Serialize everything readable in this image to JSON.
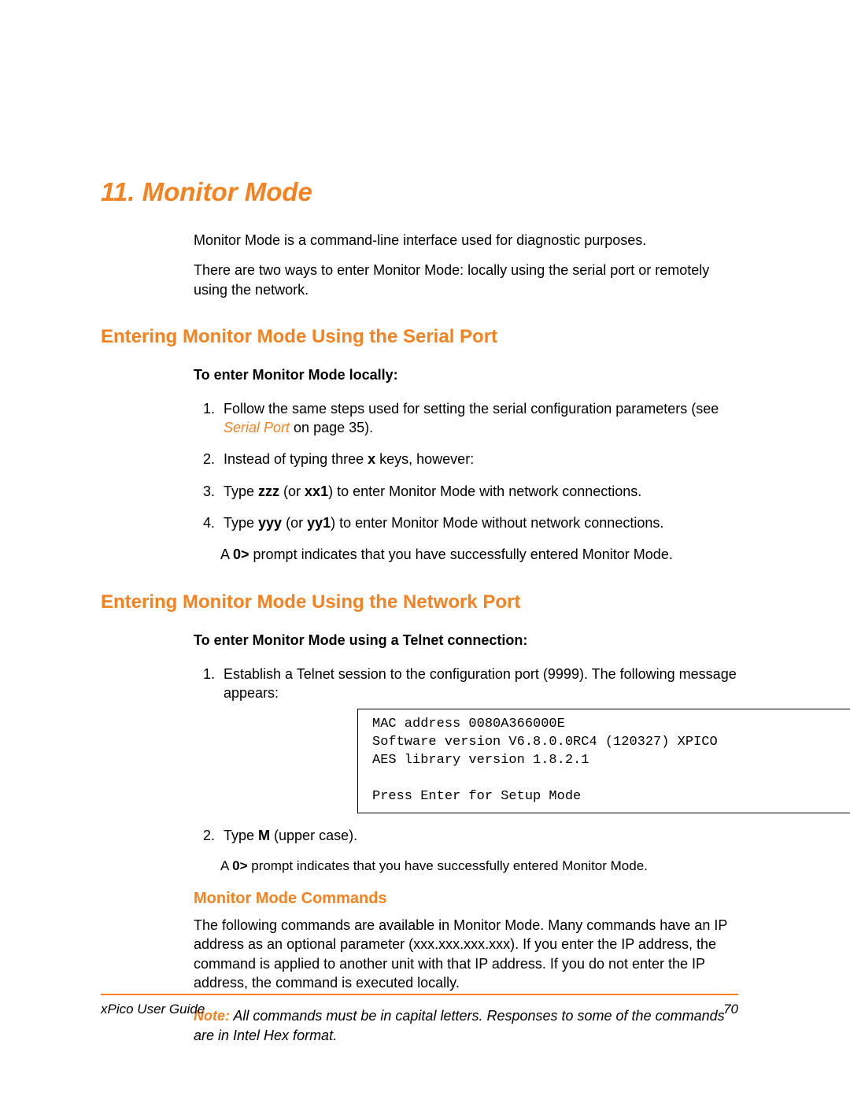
{
  "h1": "11. Monitor Mode",
  "intro": {
    "p1": "Monitor Mode is a command-line interface used for diagnostic purposes.",
    "p2": "There are two ways to enter Monitor Mode: locally using the serial port or remotely using the network."
  },
  "section1": {
    "heading": "Entering Monitor Mode Using the Serial Port",
    "sub": "To enter Monitor Mode locally:",
    "step1_pre": "Follow the same steps used for setting the serial configuration parameters (see ",
    "step1_link": "Serial Port",
    "step1_post": " on page 35).",
    "step2_pre": "Instead of typing three ",
    "step2_b": "x",
    "step2_post": " keys, however:",
    "step3_a": "Type ",
    "step3_b1": "zzz",
    "step3_b": " (or ",
    "step3_b2": "xx1",
    "step3_c": ") to enter Monitor Mode with network connections.",
    "step4_a": "Type ",
    "step4_b1": "yyy",
    "step4_b": " (or ",
    "step4_b2": "yy1",
    "step4_c": ") to enter Monitor Mode without network connections.",
    "result_a": "A ",
    "result_b": "0>",
    "result_c": " prompt indicates that you have successfully entered Monitor Mode."
  },
  "section2": {
    "heading": "Entering Monitor Mode Using the Network Port",
    "sub": "To enter Monitor Mode using a Telnet connection:",
    "step1": "Establish a Telnet session to the configuration port (9999). The following message appears:",
    "code": "MAC address 0080A366000E\nSoftware version V6.8.0.0RC4 (120327) XPICO\nAES library version 1.8.2.1\n\nPress Enter for Setup Mode",
    "step2_a": "Type ",
    "step2_b": "M",
    "step2_c": " (upper case).",
    "result_a": "A ",
    "result_b": "0>",
    "result_c": " prompt indicates that you have successfully entered Monitor Mode."
  },
  "section3": {
    "heading": "Monitor Mode Commands",
    "para": "The following commands are available in Monitor Mode. Many commands have an IP address as an optional parameter (xxx.xxx.xxx.xxx). If you enter the IP address, the command is applied to another unit with that IP address. If you do not enter the IP address, the command is executed locally.",
    "note_label": "Note:",
    "note_text": " All commands must be in capital letters. Responses to some of the commands are in Intel Hex format."
  },
  "footer": {
    "left": "xPico User Guide",
    "right": "70"
  }
}
